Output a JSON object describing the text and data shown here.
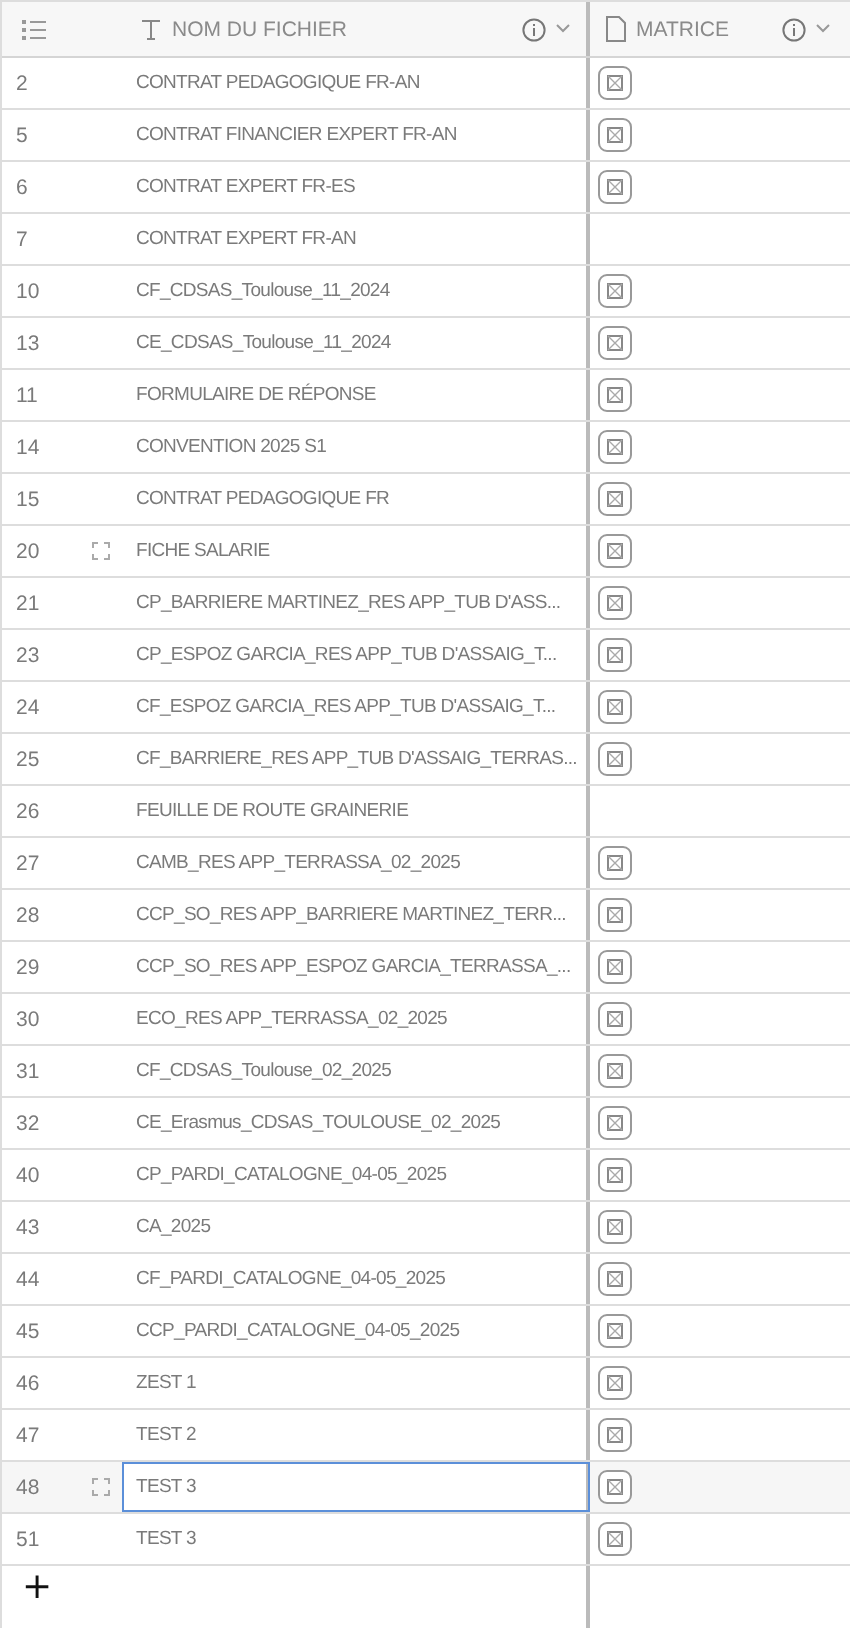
{
  "columns": [
    {
      "kind": "index"
    },
    {
      "kind": "text",
      "label": "NOM DU FICHIER"
    },
    {
      "kind": "file",
      "label": "MATRICE"
    }
  ],
  "rows": [
    {
      "number": "2",
      "name": "CONTRAT PEDAGOGIQUE FR-AN",
      "has_file": true,
      "expand_icon": false,
      "selected": false
    },
    {
      "number": "5",
      "name": "CONTRAT FINANCIER EXPERT FR-AN",
      "has_file": true,
      "expand_icon": false,
      "selected": false
    },
    {
      "number": "6",
      "name": "CONTRAT EXPERT FR-ES",
      "has_file": true,
      "expand_icon": false,
      "selected": false
    },
    {
      "number": "7",
      "name": "CONTRAT EXPERT FR-AN",
      "has_file": false,
      "expand_icon": false,
      "selected": false
    },
    {
      "number": "10",
      "name": "CF_CDSAS_Toulouse_11_2024",
      "has_file": true,
      "expand_icon": false,
      "selected": false
    },
    {
      "number": "13",
      "name": "CE_CDSAS_Toulouse_11_2024",
      "has_file": true,
      "expand_icon": false,
      "selected": false
    },
    {
      "number": "11",
      "name": "FORMULAIRE DE RÉPONSE",
      "has_file": true,
      "expand_icon": false,
      "selected": false
    },
    {
      "number": "14",
      "name": "CONVENTION 2025 S1",
      "has_file": true,
      "expand_icon": false,
      "selected": false
    },
    {
      "number": "15",
      "name": "CONTRAT PEDAGOGIQUE FR",
      "has_file": true,
      "expand_icon": false,
      "selected": false
    },
    {
      "number": "20",
      "name": "FICHE SALARIE",
      "has_file": true,
      "expand_icon": true,
      "selected": false
    },
    {
      "number": "21",
      "name": "CP_BARRIERE MARTINEZ_RES APP_TUB D'ASS...",
      "has_file": true,
      "expand_icon": false,
      "selected": false
    },
    {
      "number": "23",
      "name": "CP_ESPOZ GARCIA_RES APP_TUB D'ASSAIG_T...",
      "has_file": true,
      "expand_icon": false,
      "selected": false
    },
    {
      "number": "24",
      "name": "CF_ESPOZ GARCIA_RES APP_TUB D'ASSAIG_T...",
      "has_file": true,
      "expand_icon": false,
      "selected": false
    },
    {
      "number": "25",
      "name": "CF_BARRIERE_RES APP_TUB D'ASSAIG_TERRAS...",
      "has_file": true,
      "expand_icon": false,
      "selected": false
    },
    {
      "number": "26",
      "name": "FEUILLE DE ROUTE GRAINERIE",
      "has_file": false,
      "expand_icon": false,
      "selected": false
    },
    {
      "number": "27",
      "name": "CAMB_RES APP_TERRASSA_02_2025",
      "has_file": true,
      "expand_icon": false,
      "selected": false
    },
    {
      "number": "28",
      "name": "CCP_SO_RES APP_BARRIERE MARTINEZ_TERR...",
      "has_file": true,
      "expand_icon": false,
      "selected": false
    },
    {
      "number": "29",
      "name": "CCP_SO_RES APP_ESPOZ GARCIA_TERRASSA_...",
      "has_file": true,
      "expand_icon": false,
      "selected": false
    },
    {
      "number": "30",
      "name": "ECO_RES APP_TERRASSA_02_2025",
      "has_file": true,
      "expand_icon": false,
      "selected": false
    },
    {
      "number": "31",
      "name": "CF_CDSAS_Toulouse_02_2025",
      "has_file": true,
      "expand_icon": false,
      "selected": false
    },
    {
      "number": "32",
      "name": "CE_Erasmus_CDSAS_TOULOUSE_02_2025",
      "has_file": true,
      "expand_icon": false,
      "selected": false
    },
    {
      "number": "40",
      "name": "CP_PARDI_CATALOGNE_04-05_2025",
      "has_file": true,
      "expand_icon": false,
      "selected": false
    },
    {
      "number": "43",
      "name": "CA_2025",
      "has_file": true,
      "expand_icon": false,
      "selected": false
    },
    {
      "number": "44",
      "name": "CF_PARDI_CATALOGNE_04-05_2025",
      "has_file": true,
      "expand_icon": false,
      "selected": false
    },
    {
      "number": "45",
      "name": "CCP_PARDI_CATALOGNE_04-05_2025",
      "has_file": true,
      "expand_icon": false,
      "selected": false
    },
    {
      "number": "46",
      "name": "ZEST 1",
      "has_file": true,
      "expand_icon": false,
      "selected": false
    },
    {
      "number": "47",
      "name": "TEST 2",
      "has_file": true,
      "expand_icon": false,
      "selected": false
    },
    {
      "number": "48",
      "name": "TEST 3",
      "has_file": true,
      "expand_icon": true,
      "selected": true
    },
    {
      "number": "51",
      "name": "TEST 3",
      "has_file": true,
      "expand_icon": false,
      "selected": false
    }
  ],
  "add_row": "+"
}
